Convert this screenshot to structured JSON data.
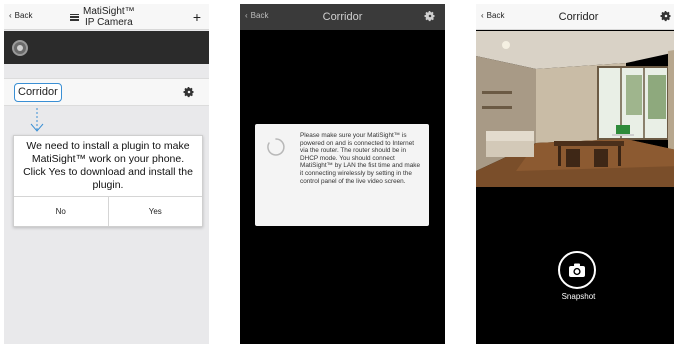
{
  "screen1": {
    "back_label": "Back",
    "title_line1": "MatiSight™",
    "title_line2": "IP Camera",
    "add_icon": "plus-icon",
    "camera_name": "Corridor",
    "dialog": {
      "message": "We need to install a plugin to make MatiSight™ work on your phone. Click Yes to download and install the plugin.",
      "no_label": "No",
      "yes_label": "Yes"
    },
    "accent_color": "#3a8fd4"
  },
  "screen2": {
    "back_label": "Back",
    "title": "Corridor",
    "loading_message": "Please make sure your MatiSight™ is powered on and is connected to Internet via the router. The router should be in DHCP mode. You should connect MatiSight™ by LAN the fist time and make it connecting wirelessly by setting in the control panel of the live video screen."
  },
  "screen3": {
    "back_label": "Back",
    "title": "Corridor",
    "snapshot_label": "Snapshot"
  }
}
